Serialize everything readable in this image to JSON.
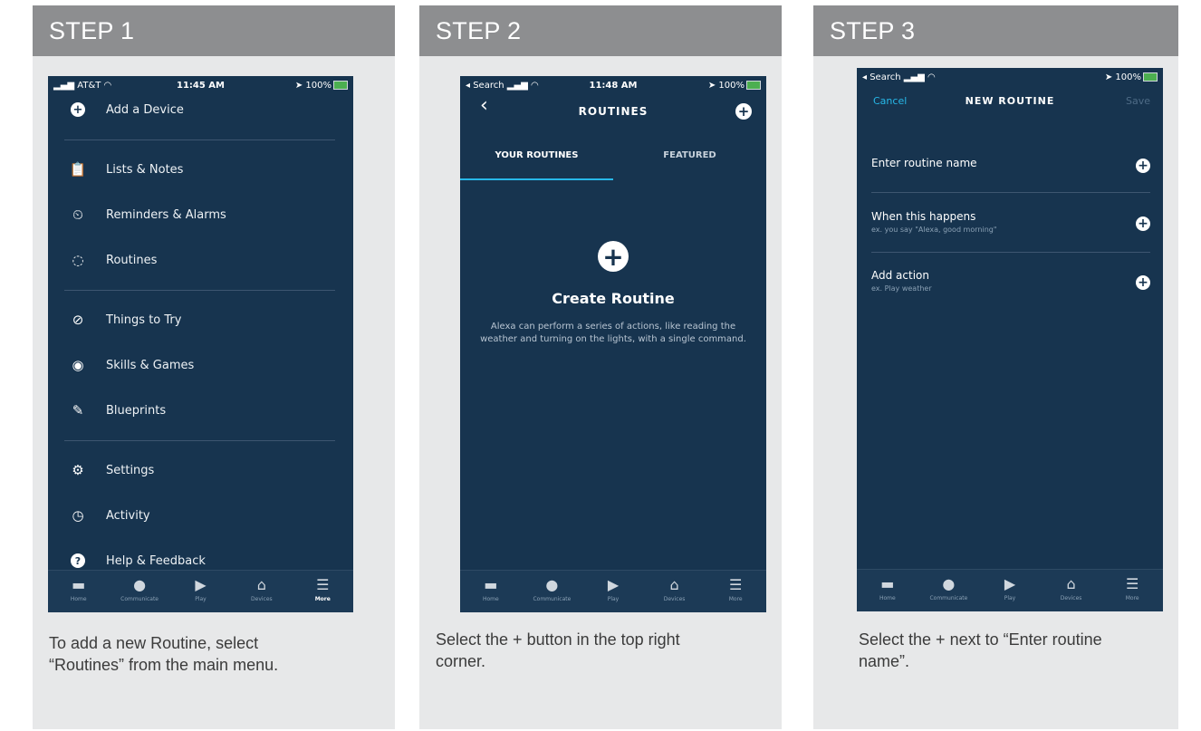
{
  "steps": [
    {
      "title": "STEP 1",
      "caption": "To add a new Routine, select “Routines” from the main menu.",
      "status": {
        "carrier": "AT&T",
        "time": "11:45 AM",
        "battery": "100%"
      },
      "menu": [
        "Add a Device",
        "Lists & Notes",
        "Reminders & Alarms",
        "Routines",
        "Things to Try",
        "Skills & Games",
        "Blueprints",
        "Settings",
        "Activity",
        "Help & Feedback"
      ]
    },
    {
      "title": "STEP 2",
      "caption": "Select the + button in the top right corner.",
      "status": {
        "carrier": "◂ Search",
        "time": "11:48 AM",
        "battery": "100%"
      },
      "header_title": "ROUTINES",
      "tabs": [
        "YOUR ROUTINES",
        "FEATURED"
      ],
      "create_title": "Create Routine",
      "create_desc": "Alexa can perform a series of actions, like reading the weather and turning on the lights, with a single command."
    },
    {
      "title": "STEP 3",
      "caption": "Select the + next to “Enter routine name”.",
      "status": {
        "carrier": "◂ Search",
        "battery": "100%"
      },
      "cancel": "Cancel",
      "header_title": "NEW ROUTINE",
      "save": "Save",
      "rows": [
        {
          "title": "Enter routine name",
          "sub": ""
        },
        {
          "title": "When this happens",
          "sub": "ex. you say \"Alexa, good morning\""
        },
        {
          "title": "Add action",
          "sub": "ex. Play weather"
        }
      ]
    }
  ],
  "tabbar": [
    "Home",
    "Communicate",
    "Play",
    "Devices",
    "More"
  ]
}
